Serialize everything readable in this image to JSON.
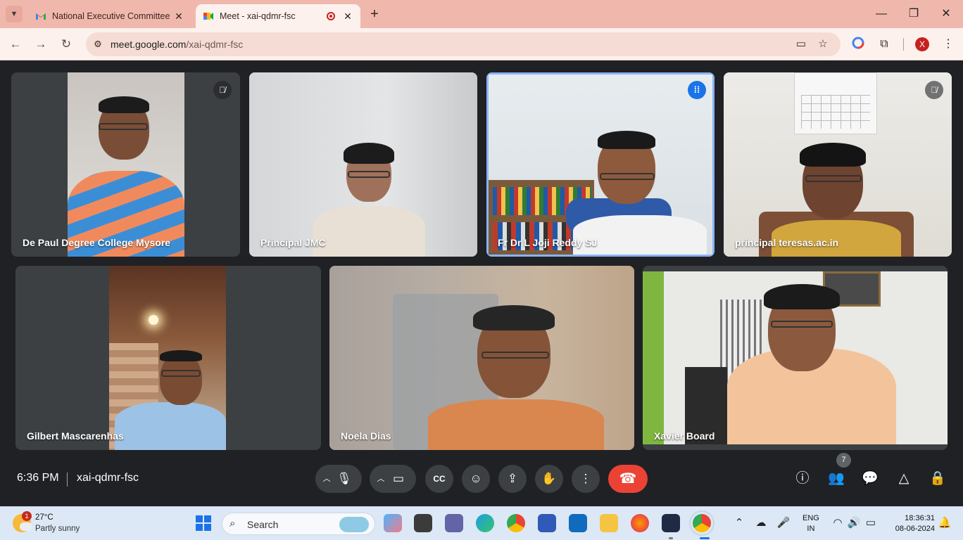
{
  "browser": {
    "tabs": [
      {
        "title": "National Executive Committee",
        "favicon": "gmail-icon",
        "active": false
      },
      {
        "title": "Meet - xai-qdmr-fsc",
        "favicon": "meet-icon",
        "active": true,
        "recording": true
      }
    ],
    "url_domain": "meet.google.com",
    "url_path": "/xai-qdmr-fsc",
    "profile_initial": "X"
  },
  "meet": {
    "time": "6:36 PM",
    "meeting_code": "xai-qdmr-fsc",
    "people_count": "7",
    "participants": [
      {
        "name": "De Paul Degree College Mysore",
        "muted": true
      },
      {
        "name": "Principal JMC",
        "muted": false
      },
      {
        "name": "Fr Dr L Joji Reddy SJ",
        "muted": false,
        "speaking": true
      },
      {
        "name": "principal teresas.ac.in",
        "muted": true
      },
      {
        "name": "Gilbert Mascarenhas",
        "muted": false
      },
      {
        "name": "Noela Dias",
        "muted": false
      },
      {
        "name": "Xavier Board",
        "muted": false
      }
    ],
    "colors": {
      "hangup": "#ea4335",
      "speaking": "#1a73e8",
      "background": "#202124"
    }
  },
  "taskbar": {
    "weather_temp": "27°C",
    "weather_condition": "Partly sunny",
    "weather_badge": "1",
    "search_label": "Search",
    "lang_line1": "ENG",
    "lang_line2": "IN",
    "time": "18:36:31",
    "date": "08-06-2024"
  }
}
